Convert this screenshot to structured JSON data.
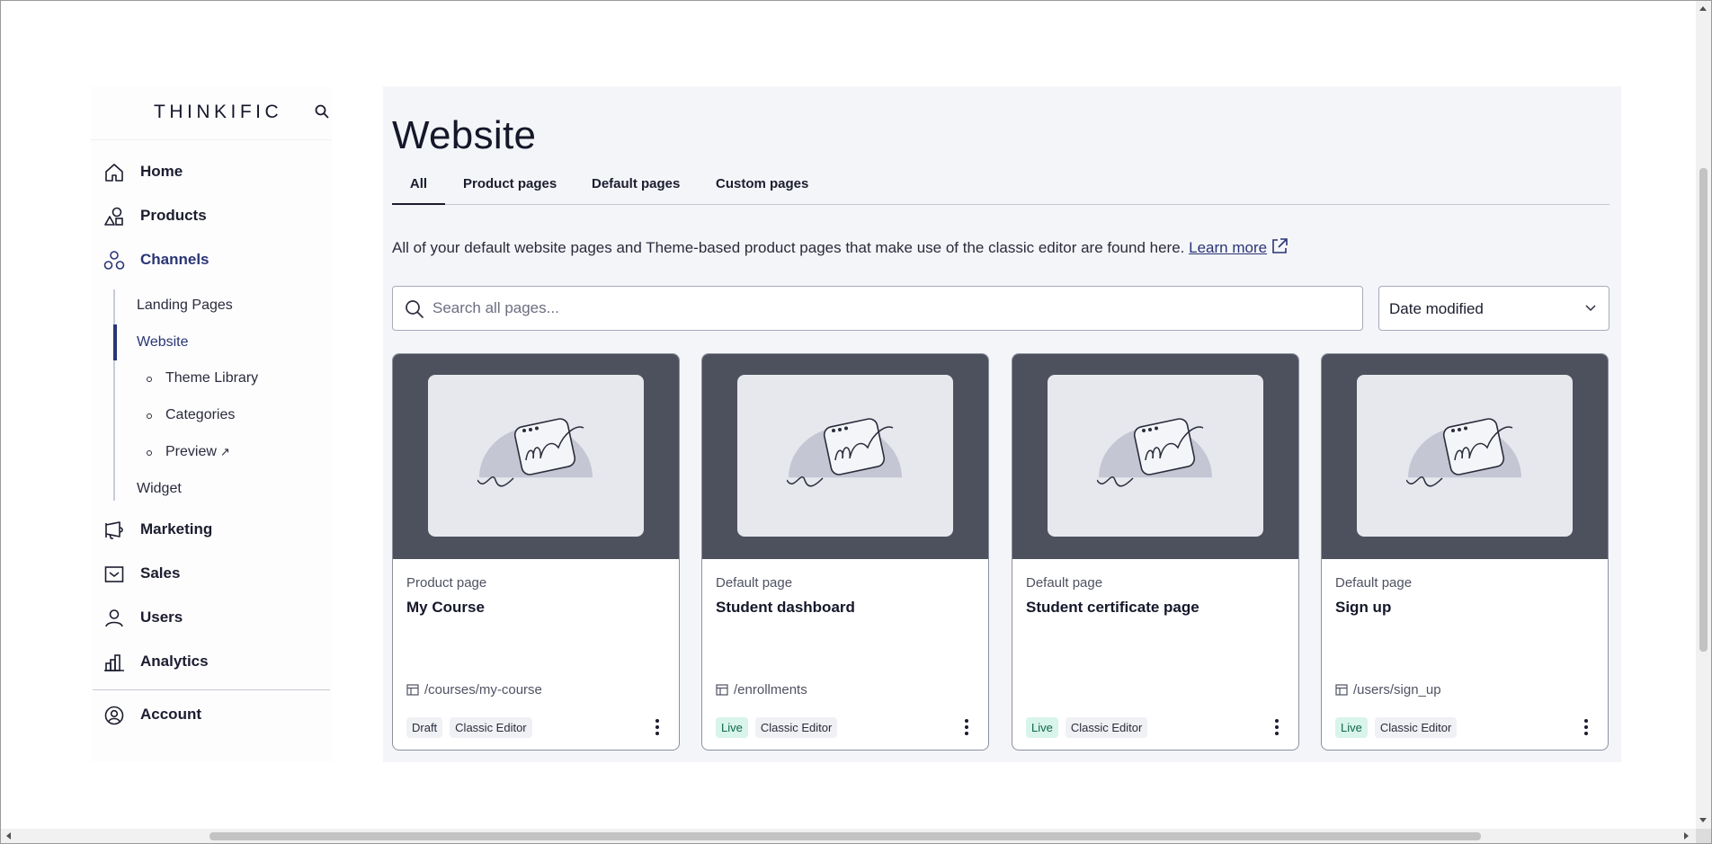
{
  "sidebar": {
    "logo": "THINKIFIC",
    "nav": [
      {
        "label": "Home",
        "icon": "home-icon"
      },
      {
        "label": "Products",
        "icon": "shapes-icon"
      },
      {
        "label": "Channels",
        "icon": "channels-icon"
      },
      {
        "label": "Marketing",
        "icon": "megaphone-icon"
      },
      {
        "label": "Sales",
        "icon": "envelope-icon"
      },
      {
        "label": "Users",
        "icon": "person-icon"
      },
      {
        "label": "Analytics",
        "icon": "bar-chart-icon"
      },
      {
        "label": "Account",
        "icon": "account-circle-icon"
      }
    ],
    "channels_sub": {
      "landing_pages": "Landing Pages",
      "website": "Website",
      "theme_library": "Theme Library",
      "categories": "Categories",
      "preview": "Preview",
      "preview_arrow": "↗",
      "widget": "Widget"
    }
  },
  "main": {
    "title": "Website",
    "tabs": [
      {
        "label": "All",
        "active": true
      },
      {
        "label": "Product pages"
      },
      {
        "label": "Default pages"
      },
      {
        "label": "Custom pages"
      }
    ],
    "intro_text": "All of your default website pages and Theme-based product pages that make use of the classic editor are found here.",
    "learn_more": "Learn more",
    "search": {
      "placeholder": "Search all pages..."
    },
    "sort": {
      "selected": "Date modified"
    },
    "cards": [
      {
        "type": "Product page",
        "title": "My Course",
        "url": "/courses/my-course",
        "status": "Draft",
        "editor": "Classic Editor"
      },
      {
        "type": "Default page",
        "title": "Student dashboard",
        "url": "/enrollments",
        "status": "Live",
        "editor": "Classic Editor"
      },
      {
        "type": "Default page",
        "title": "Student certificate page",
        "url": "",
        "status": "Live",
        "editor": "Classic Editor"
      },
      {
        "type": "Default page",
        "title": "Sign up",
        "url": "/users/sign_up",
        "status": "Live",
        "editor": "Classic Editor"
      }
    ]
  },
  "colors": {
    "accent": "#2a3575",
    "live_badge_bg": "#d9f4ea",
    "thumb_bg": "#4d515e",
    "main_bg": "#f4f5f8"
  }
}
